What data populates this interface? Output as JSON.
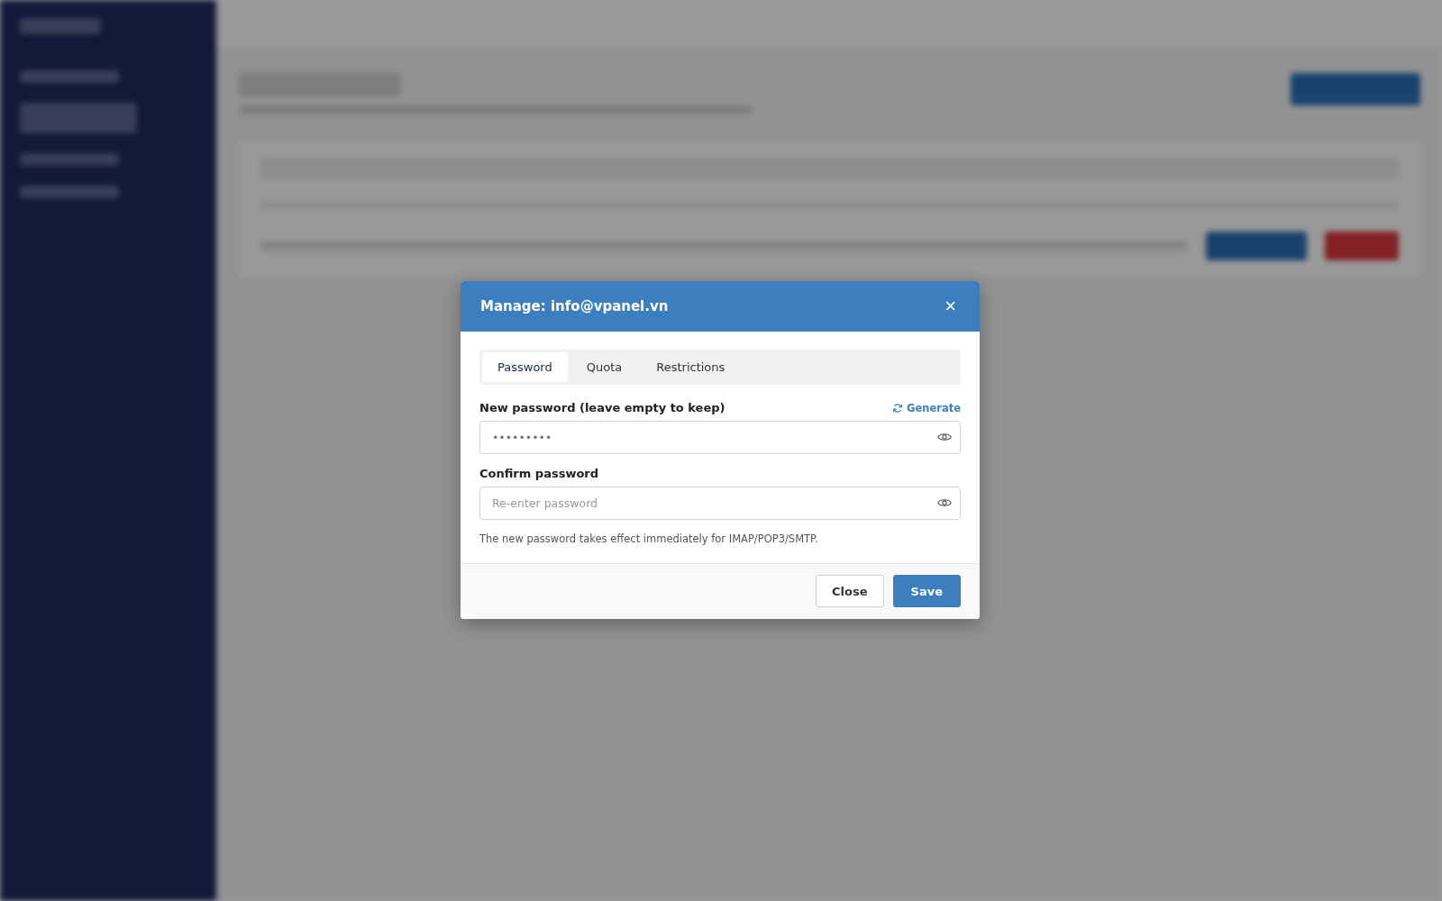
{
  "dialog": {
    "title": "Manage: info@vpanel.vn",
    "close_icon": "×",
    "tabs": [
      {
        "label": "Password",
        "selected": true
      },
      {
        "label": "Quota",
        "selected": false
      },
      {
        "label": "Restrictions",
        "selected": false
      }
    ],
    "fields": [
      {
        "label": "New password (leave empty to keep)",
        "value": "•••••••••",
        "action": "Generate"
      },
      {
        "label": "Confirm password",
        "placeholder": "Re-enter password"
      }
    ],
    "hint": "The new password takes effect immediately for IMAP/POP3/SMTP.",
    "buttons": [
      {
        "label": "Close",
        "kind": "secondary"
      },
      {
        "label": "Save",
        "kind": "primary"
      }
    ]
  }
}
